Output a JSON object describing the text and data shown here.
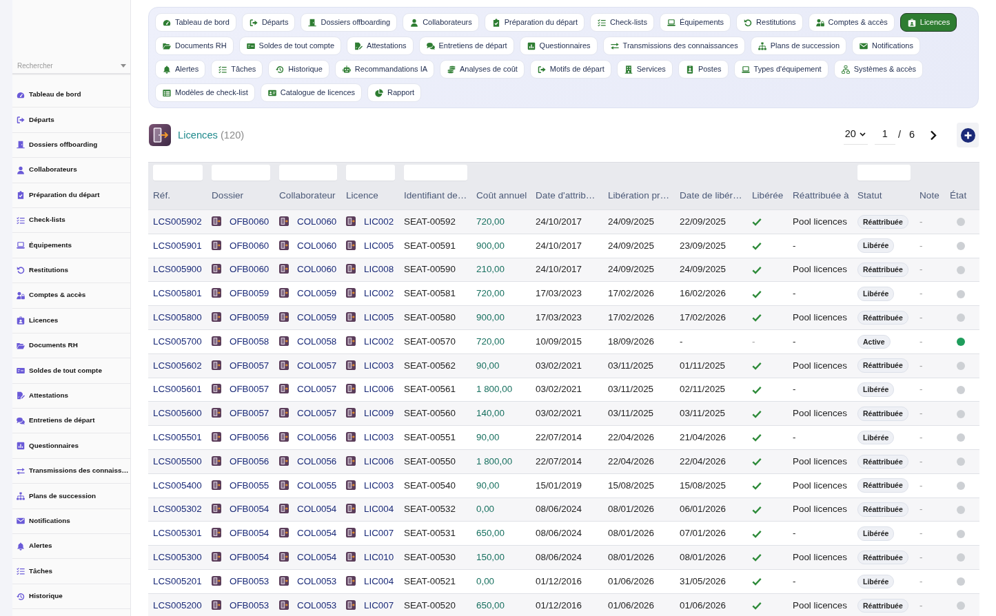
{
  "sidebar": {
    "search": {
      "placeholder": "Rechercher"
    },
    "items": [
      {
        "label": "Tableau de bord"
      },
      {
        "label": "Départs"
      },
      {
        "label": "Dossiers offboarding"
      },
      {
        "label": "Collaborateurs"
      },
      {
        "label": "Préparation du départ"
      },
      {
        "label": "Check-lists"
      },
      {
        "label": "Équipements"
      },
      {
        "label": "Restitutions"
      },
      {
        "label": "Comptes & accès"
      },
      {
        "label": "Licences"
      },
      {
        "label": "Documents RH"
      },
      {
        "label": "Soldes de tout compte"
      },
      {
        "label": "Attestations"
      },
      {
        "label": "Entretiens de départ"
      },
      {
        "label": "Questionnaires"
      },
      {
        "label": "Transmissions des connaiss…"
      },
      {
        "label": "Plans de succession"
      },
      {
        "label": "Notifications"
      },
      {
        "label": "Alertes"
      },
      {
        "label": "Tâches"
      },
      {
        "label": "Historique"
      }
    ]
  },
  "nav_rows": [
    [
      {
        "label": "Tableau de bord",
        "selected": false
      },
      {
        "label": "Départs",
        "selected": false
      },
      {
        "label": "Dossiers offboarding",
        "selected": false
      },
      {
        "label": "Collaborateurs",
        "selected": false
      },
      {
        "label": "Préparation du départ",
        "selected": false
      },
      {
        "label": "Check-lists",
        "selected": false
      },
      {
        "label": "Équipements",
        "selected": false
      },
      {
        "label": "Restitutions",
        "selected": false
      },
      {
        "label": "Comptes & accès",
        "selected": false
      },
      {
        "label": "Licences",
        "selected": true
      }
    ],
    [
      {
        "label": "Documents RH",
        "selected": false
      },
      {
        "label": "Soldes de tout compte",
        "selected": false
      },
      {
        "label": "Attestations",
        "selected": false
      },
      {
        "label": "Entretiens de départ",
        "selected": false
      },
      {
        "label": "Questionnaires",
        "selected": false
      },
      {
        "label": "Transmissions des connaissances",
        "selected": false
      },
      {
        "label": "Plans de succession",
        "selected": false
      },
      {
        "label": "Notifications",
        "selected": false
      }
    ],
    [
      {
        "label": "Alertes",
        "selected": false
      },
      {
        "label": "Tâches",
        "selected": false
      },
      {
        "label": "Historique",
        "selected": false
      },
      {
        "label": "Recommandations IA",
        "selected": false
      },
      {
        "label": "Analyses de coût",
        "selected": false
      },
      {
        "label": "Motifs de départ",
        "selected": false
      },
      {
        "label": "Services",
        "selected": false
      },
      {
        "label": "Postes",
        "selected": false
      },
      {
        "label": "Types d'équipement",
        "selected": false
      },
      {
        "label": "Systèmes & accès",
        "selected": false
      }
    ],
    [
      {
        "label": "Modèles de check-list",
        "selected": false
      },
      {
        "label": "Catalogue de licences",
        "selected": false
      },
      {
        "label": "Rapport",
        "selected": false
      }
    ]
  ],
  "header": {
    "title": "Licences",
    "count": "(120)",
    "page_size": "20",
    "page": "1",
    "separator": "/",
    "page_count": "6"
  },
  "table": {
    "columns": [
      {
        "label": "Réf.",
        "filter": true
      },
      {
        "label": "Dossier",
        "filter": true
      },
      {
        "label": "Collaborateur",
        "filter": true
      },
      {
        "label": "Licence",
        "filter": true
      },
      {
        "label": "Identifiant de…",
        "filter": true
      },
      {
        "label": "Coût annuel",
        "filter": false
      },
      {
        "label": "Date d'attrib…",
        "filter": false
      },
      {
        "label": "Libération pr…",
        "filter": false
      },
      {
        "label": "Date de libér…",
        "filter": false
      },
      {
        "label": "Libérée",
        "filter": false
      },
      {
        "label": "Réattribuée à",
        "filter": false
      },
      {
        "label": "Statut",
        "filter": true
      },
      {
        "label": "Note",
        "filter": false
      },
      {
        "label": "État",
        "filter": false
      }
    ],
    "rows": [
      {
        "ref": "LCS005902",
        "dossier": "OFB0060",
        "collaborateur": "COL0060",
        "licence": "LIC002",
        "column_5": "SEAT-00592",
        "cout_annuel": "720,00",
        "column_7": "24/10/2017",
        "column_8": "24/09/2025",
        "column_9": "22/09/2025",
        "liberee": true,
        "reattribuee_a": "Pool licences",
        "statut": "Réattribuée",
        "note": "-",
        "color": "#cdd0d4"
      },
      {
        "ref": "LCS005901",
        "dossier": "OFB0060",
        "collaborateur": "COL0060",
        "licence": "LIC005",
        "column_5": "SEAT-00591",
        "cout_annuel": "900,00",
        "column_7": "24/10/2017",
        "column_8": "24/09/2025",
        "column_9": "23/09/2025",
        "liberee": true,
        "reattribuee_a": "-",
        "statut": "Libérée",
        "note": "-",
        "color": "#cdd0d4"
      },
      {
        "ref": "LCS005900",
        "dossier": "OFB0060",
        "collaborateur": "COL0060",
        "licence": "LIC008",
        "column_5": "SEAT-00590",
        "cout_annuel": "210,00",
        "column_7": "24/10/2017",
        "column_8": "24/09/2025",
        "column_9": "24/09/2025",
        "liberee": true,
        "reattribuee_a": "Pool licences",
        "statut": "Réattribuée",
        "note": "-",
        "color": "#cdd0d4"
      },
      {
        "ref": "LCS005801",
        "dossier": "OFB0059",
        "collaborateur": "COL0059",
        "licence": "LIC002",
        "column_5": "SEAT-00581",
        "cout_annuel": "720,00",
        "column_7": "17/03/2023",
        "column_8": "17/02/2026",
        "column_9": "16/02/2026",
        "liberee": true,
        "reattribuee_a": "-",
        "statut": "Libérée",
        "note": "-",
        "color": "#cdd0d4"
      },
      {
        "ref": "LCS005800",
        "dossier": "OFB0059",
        "collaborateur": "COL0059",
        "licence": "LIC005",
        "column_5": "SEAT-00580",
        "cout_annuel": "900,00",
        "column_7": "17/03/2023",
        "column_8": "17/02/2026",
        "column_9": "17/02/2026",
        "liberee": true,
        "reattribuee_a": "Pool licences",
        "statut": "Réattribuée",
        "note": "-",
        "color": "#cdd0d4"
      },
      {
        "ref": "LCS005700",
        "dossier": "OFB0058",
        "collaborateur": "COL0058",
        "licence": "LIC002",
        "column_5": "SEAT-00570",
        "cout_annuel": "720,00",
        "column_7": "10/09/2015",
        "column_8": "18/09/2026",
        "column_9": "-",
        "liberee": false,
        "liberee_text": "-",
        "reattribuee_a": "-",
        "statut": "Active",
        "note": "-",
        "color": "#1f9d5c"
      },
      {
        "ref": "LCS005602",
        "dossier": "OFB0057",
        "collaborateur": "COL0057",
        "licence": "LIC003",
        "column_5": "SEAT-00562",
        "cout_annuel": "90,00",
        "column_7": "03/02/2021",
        "column_8": "03/11/2025",
        "column_9": "01/11/2025",
        "liberee": true,
        "reattribuee_a": "Pool licences",
        "statut": "Réattribuée",
        "note": "-",
        "color": "#cdd0d4"
      },
      {
        "ref": "LCS005601",
        "dossier": "OFB0057",
        "collaborateur": "COL0057",
        "licence": "LIC006",
        "column_5": "SEAT-00561",
        "cout_annuel": "1 800,00",
        "column_7": "03/02/2021",
        "column_8": "03/11/2025",
        "column_9": "02/11/2025",
        "liberee": true,
        "reattribuee_a": "-",
        "statut": "Libérée",
        "note": "-",
        "color": "#cdd0d4"
      },
      {
        "ref": "LCS005600",
        "dossier": "OFB0057",
        "collaborateur": "COL0057",
        "licence": "LIC009",
        "column_5": "SEAT-00560",
        "cout_annuel": "140,00",
        "column_7": "03/02/2021",
        "column_8": "03/11/2025",
        "column_9": "03/11/2025",
        "liberee": true,
        "reattribuee_a": "Pool licences",
        "statut": "Réattribuée",
        "note": "-",
        "color": "#cdd0d4"
      },
      {
        "ref": "LCS005501",
        "dossier": "OFB0056",
        "collaborateur": "COL0056",
        "licence": "LIC003",
        "column_5": "SEAT-00551",
        "cout_annuel": "90,00",
        "column_7": "22/07/2014",
        "column_8": "22/04/2026",
        "column_9": "21/04/2026",
        "liberee": true,
        "reattribuee_a": "-",
        "statut": "Libérée",
        "note": "-",
        "color": "#cdd0d4"
      },
      {
        "ref": "LCS005500",
        "dossier": "OFB0056",
        "collaborateur": "COL0056",
        "licence": "LIC006",
        "column_5": "SEAT-00550",
        "cout_annuel": "1 800,00",
        "column_7": "22/07/2014",
        "column_8": "22/04/2026",
        "column_9": "22/04/2026",
        "liberee": true,
        "reattribuee_a": "Pool licences",
        "statut": "Réattribuée",
        "note": "-",
        "color": "#cdd0d4"
      },
      {
        "ref": "LCS005400",
        "dossier": "OFB0055",
        "collaborateur": "COL0055",
        "licence": "LIC003",
        "column_5": "SEAT-00540",
        "cout_annuel": "90,00",
        "column_7": "15/01/2019",
        "column_8": "15/08/2025",
        "column_9": "15/08/2025",
        "liberee": true,
        "reattribuee_a": "Pool licences",
        "statut": "Réattribuée",
        "note": "-",
        "color": "#cdd0d4"
      },
      {
        "ref": "LCS005302",
        "dossier": "OFB0054",
        "collaborateur": "COL0054",
        "licence": "LIC004",
        "column_5": "SEAT-00532",
        "cout_annuel": "0,00",
        "column_7": "08/06/2024",
        "column_8": "08/01/2026",
        "column_9": "06/01/2026",
        "liberee": true,
        "reattribuee_a": "Pool licences",
        "statut": "Réattribuée",
        "note": "-",
        "color": "#cdd0d4"
      },
      {
        "ref": "LCS005301",
        "dossier": "OFB0054",
        "collaborateur": "COL0054",
        "licence": "LIC007",
        "column_5": "SEAT-00531",
        "cout_annuel": "650,00",
        "column_7": "08/06/2024",
        "column_8": "08/01/2026",
        "column_9": "07/01/2026",
        "liberee": true,
        "reattribuee_a": "-",
        "statut": "Libérée",
        "note": "-",
        "color": "#cdd0d4"
      },
      {
        "ref": "LCS005300",
        "dossier": "OFB0054",
        "collaborateur": "COL0054",
        "licence": "LIC010",
        "column_5": "SEAT-00530",
        "cout_annuel": "150,00",
        "column_7": "08/06/2024",
        "column_8": "08/01/2026",
        "column_9": "08/01/2026",
        "liberee": true,
        "reattribuee_a": "Pool licences",
        "statut": "Réattribuée",
        "note": "-",
        "color": "#cdd0d4"
      },
      {
        "ref": "LCS005201",
        "dossier": "OFB0053",
        "collaborateur": "COL0053",
        "licence": "LIC004",
        "column_5": "SEAT-00521",
        "cout_annuel": "0,00",
        "column_7": "01/12/2016",
        "column_8": "01/06/2026",
        "column_9": "31/05/2026",
        "liberee": true,
        "reattribuee_a": "-",
        "statut": "Libérée",
        "note": "-",
        "color": "#cdd0d4"
      },
      {
        "ref": "LCS005200",
        "dossier": "OFB0053",
        "collaborateur": "COL0053",
        "licence": "LIC007",
        "column_5": "SEAT-00520",
        "cout_annuel": "650,00",
        "column_7": "01/12/2016",
        "column_8": "01/06/2026",
        "column_9": "01/06/2026",
        "liberee": true,
        "reattribuee_a": "Pool licences",
        "statut": "Réattribuée",
        "note": "-",
        "color": "#cdd0d4"
      }
    ]
  }
}
